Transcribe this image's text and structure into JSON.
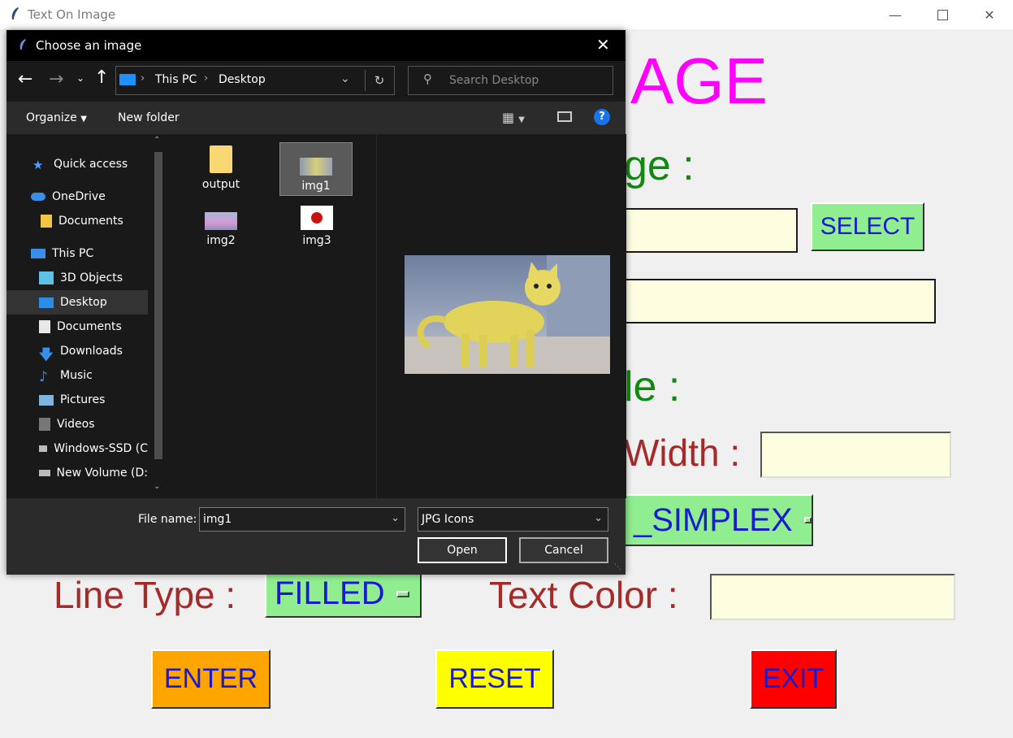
{
  "app": {
    "title": "Text On Image",
    "heading_visible": "AGE",
    "heading_color": "#ff00ff",
    "label_image": "ge :",
    "label_style": "le :",
    "label_width": "Width :",
    "label_linetype": "Line Type :",
    "label_textcolor": "Text Color :",
    "select_button": "SELECT",
    "font_option_visible": "_SIMPLEX",
    "linetype_option": "FILLED",
    "enter_button": "ENTER",
    "reset_button": "RESET",
    "exit_button": "EXIT",
    "colors": {
      "green_label": "#118811",
      "brown_label": "#a52a2a",
      "button_green": "#90ee90",
      "enter_bg": "#ffa500",
      "reset_bg": "#ffff00",
      "exit_bg": "#ff0000"
    }
  },
  "dialog": {
    "title": "Choose an image",
    "breadcrumb": [
      "This PC",
      "Desktop"
    ],
    "search_placeholder": "Search Desktop",
    "organize": "Organize",
    "new_folder": "New folder",
    "sidebar": [
      {
        "label": "Quick access",
        "icon": "star-icon"
      },
      {
        "label": "OneDrive",
        "icon": "cloud-icon"
      },
      {
        "label": "Documents",
        "icon": "folder-icon"
      },
      {
        "label": "This PC",
        "icon": "computer-icon"
      },
      {
        "label": "3D Objects",
        "icon": "cube-icon"
      },
      {
        "label": "Desktop",
        "icon": "desktop-icon"
      },
      {
        "label": "Documents",
        "icon": "document-icon"
      },
      {
        "label": "Downloads",
        "icon": "download-icon"
      },
      {
        "label": "Music",
        "icon": "music-icon"
      },
      {
        "label": "Pictures",
        "icon": "pictures-icon"
      },
      {
        "label": "Videos",
        "icon": "videos-icon"
      },
      {
        "label": "Windows-SSD (C",
        "icon": "drive-icon"
      },
      {
        "label": "New Volume (D:",
        "icon": "drive-icon"
      }
    ],
    "files": [
      {
        "name": "output",
        "kind": "folder"
      },
      {
        "name": "img1",
        "kind": "image",
        "selected": true
      },
      {
        "name": "img2",
        "kind": "image"
      },
      {
        "name": "img3",
        "kind": "image"
      }
    ],
    "file_name_label": "File name:",
    "file_name_value": "img1",
    "file_type": "JPG Icons",
    "open_button": "Open",
    "cancel_button": "Cancel"
  }
}
